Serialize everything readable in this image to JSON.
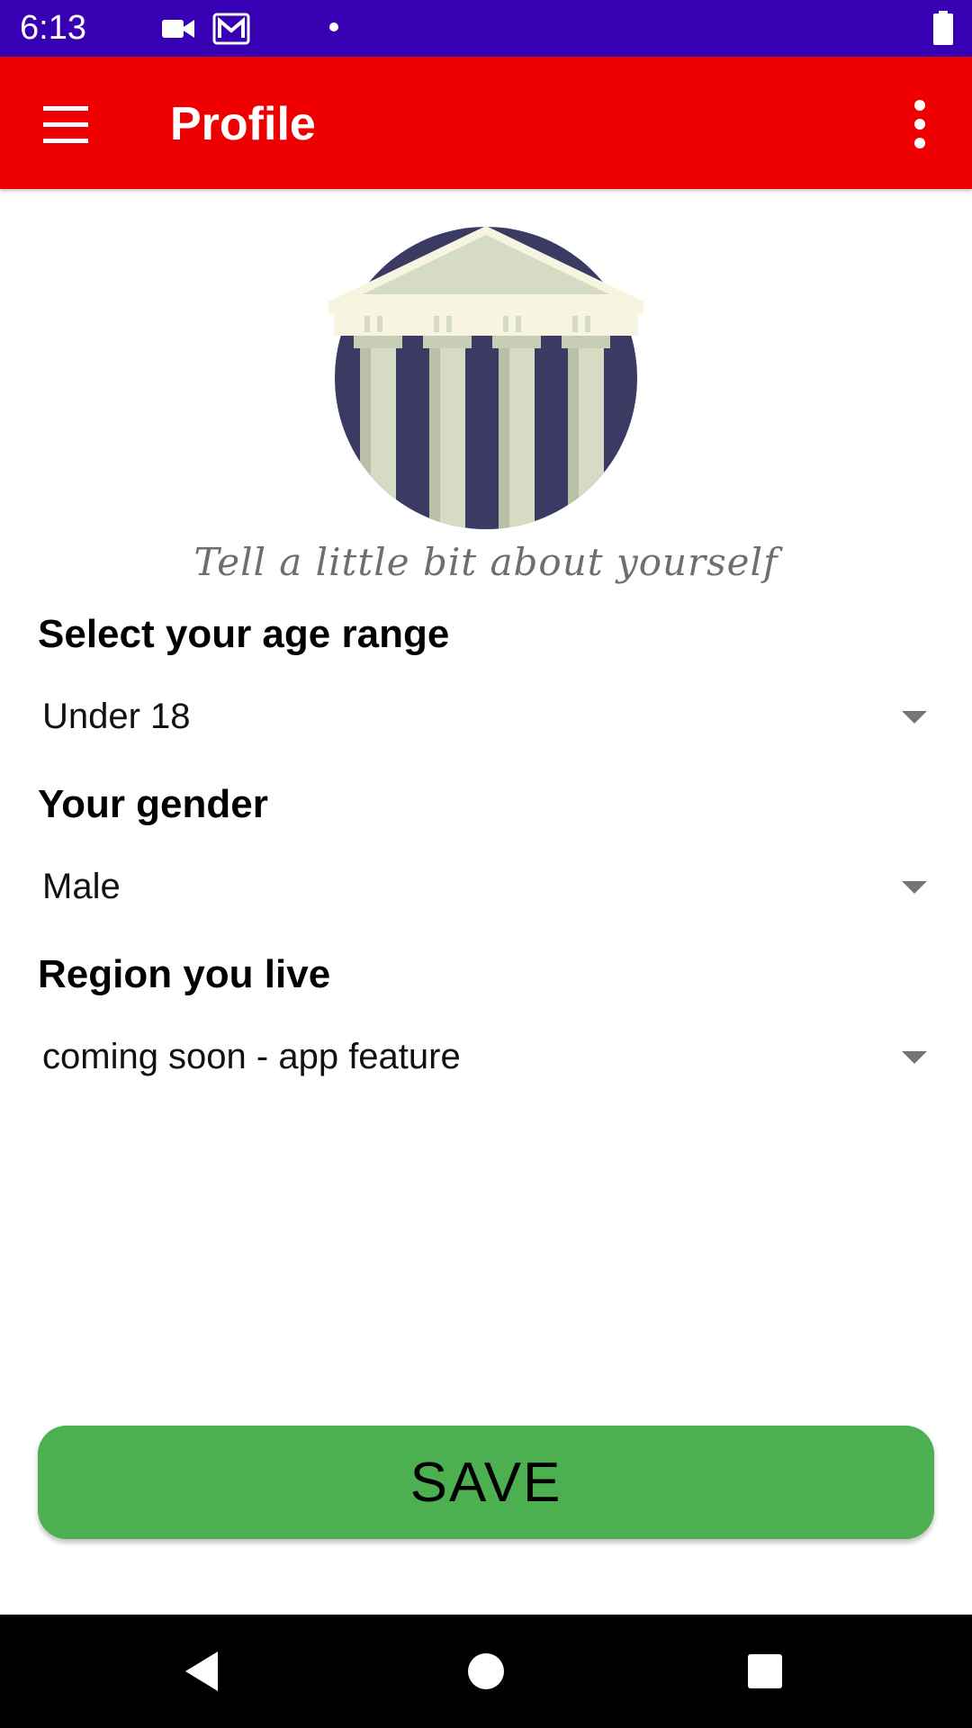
{
  "status_bar": {
    "time": "6:13",
    "icons": [
      "video-camera-icon",
      "gmail-icon",
      "notification-dot-icon",
      "battery-icon"
    ]
  },
  "app_bar": {
    "title": "Profile",
    "menu_icon": "hamburger-menu-icon",
    "overflow_icon": "more-vert-icon",
    "color": "#ee0000"
  },
  "header": {
    "logo": "columned-building-logo",
    "tagline": "Tell a little bit about yourself"
  },
  "form": {
    "age": {
      "label": "Select your age range",
      "value": "Under 18"
    },
    "gender": {
      "label": "Your gender",
      "value": "Male"
    },
    "region": {
      "label": "Region you live",
      "value": "coming soon - app feature"
    }
  },
  "save_button": {
    "label": "SAVE",
    "color": "#4caf50"
  },
  "nav_bar": {
    "icons": [
      "back-icon",
      "home-icon",
      "recents-icon"
    ]
  },
  "colors": {
    "status_bar": "#3700b3",
    "app_bar": "#ee0000",
    "save": "#4caf50",
    "logo_navy": "#3b3a63",
    "logo_column": "#d6dcc4"
  }
}
